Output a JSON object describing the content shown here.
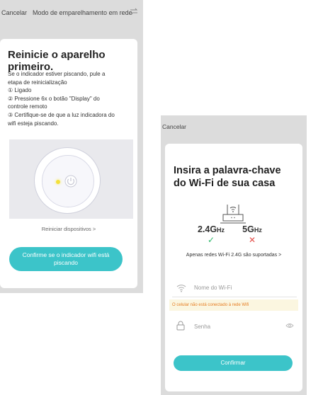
{
  "screen_reset": {
    "topbar": {
      "cancel_label": "Cancelar",
      "mode_label": "Modo de emparelhamento em rede",
      "swap_icon": "swap-arrows-icon"
    },
    "title": "Reinicie o aparelho primeiro.",
    "instructions": [
      "Se o indicador estiver piscando, pule a",
      "etapa de reinicialização",
      "① Ligado",
      "② Pressione 6x o botão \"Display\" do",
      "controle remoto",
      "③ Certifique-se de que a luz indicadora do",
      "wifi esteja piscando."
    ],
    "reset_link": "Reiniciar dispositivos >",
    "confirm_button": "Confirme se o indicador wifi está piscando",
    "colors": {
      "accent": "#3cc4c9",
      "led": "#f3e03a"
    }
  },
  "screen_wifi": {
    "cancel_label": "Cancelar",
    "title": "Insira a palavra-chave do Wi-Fi de sua casa",
    "bands": {
      "b24": {
        "value": "2.4G",
        "unit": "Hz",
        "mark": "✓",
        "supported": true
      },
      "b5": {
        "value": "5G",
        "unit": "Hz",
        "mark": "✕",
        "supported": false
      }
    },
    "supported_note": "Apenas redes Wi-Fi 2.4G são suportadas >",
    "wifi_field": {
      "placeholder": "Nome do Wi-Fi",
      "icon": "wifi-icon"
    },
    "warning": "O celular não está conectado à rede Wifi",
    "password_field": {
      "placeholder": "Senha",
      "icon": "lock-icon",
      "toggle_icon": "eye-icon"
    },
    "confirm_button": "Confirmar",
    "colors": {
      "accent": "#3cc4c9",
      "check": "#2db86b",
      "cross": "#e4504b",
      "warning": "#e57c21"
    }
  }
}
